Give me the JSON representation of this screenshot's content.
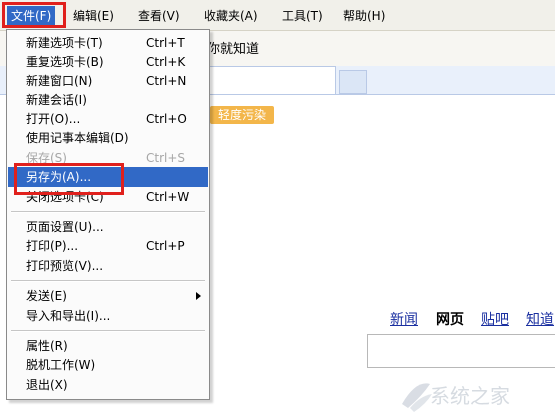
{
  "menubar": {
    "items": [
      "文件(F)",
      "编辑(E)",
      "查看(V)",
      "收藏夹(A)",
      "工具(T)",
      "帮助(H)"
    ]
  },
  "toolbar": {
    "site_text": "你就知道"
  },
  "page": {
    "pollution_badge": "轻度污染",
    "nav_links": [
      "新闻",
      "网页",
      "贴吧",
      "知道"
    ],
    "active_link": "网页"
  },
  "file_menu": {
    "items": [
      {
        "label": "新建选项卡(T)",
        "shortcut": "Ctrl+T"
      },
      {
        "label": "重复选项卡(B)",
        "shortcut": "Ctrl+K"
      },
      {
        "label": "新建窗口(N)",
        "shortcut": "Ctrl+N"
      },
      {
        "label": "新建会话(I)",
        "shortcut": ""
      },
      {
        "label": "打开(O)...",
        "shortcut": "Ctrl+O"
      },
      {
        "label": "使用记事本编辑(D)",
        "shortcut": ""
      },
      {
        "label": "保存(S)",
        "shortcut": "Ctrl+S",
        "disabled": true
      },
      {
        "label": "另存为(A)...",
        "shortcut": "",
        "selected": true
      },
      {
        "label": "关闭选项卡(C)",
        "shortcut": "Ctrl+W"
      },
      {
        "label": "页面设置(U)...",
        "shortcut": ""
      },
      {
        "label": "打印(P)...",
        "shortcut": "Ctrl+P"
      },
      {
        "label": "打印预览(V)...",
        "shortcut": ""
      },
      {
        "label": "发送(E)",
        "shortcut": "",
        "submenu": true
      },
      {
        "label": "导入和导出(I)...",
        "shortcut": ""
      },
      {
        "label": "属性(R)",
        "shortcut": ""
      },
      {
        "label": "脱机工作(W)",
        "shortcut": ""
      },
      {
        "label": "退出(X)",
        "shortcut": ""
      }
    ]
  },
  "watermark": {
    "text": "系统之家"
  },
  "colors": {
    "highlight_red": "#e0201c",
    "menu_selection": "#3169c6",
    "badge_orange": "#f3b64a",
    "link_blue": "#1a2fa0"
  }
}
